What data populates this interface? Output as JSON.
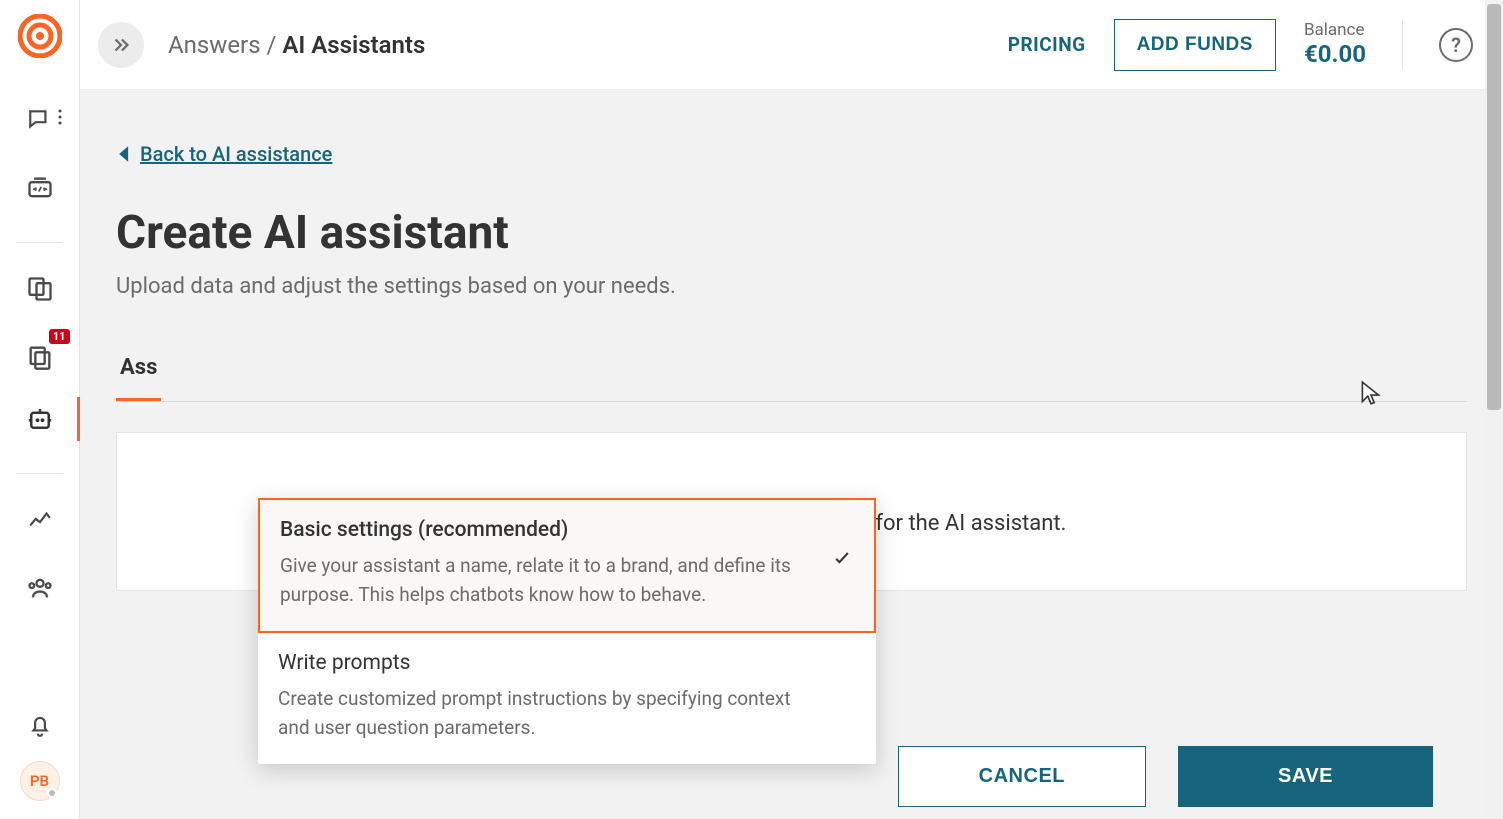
{
  "breadcrumb": {
    "parent": "Answers",
    "sep": " / ",
    "current": "AI Assistants"
  },
  "topbar": {
    "pricing": "PRICING",
    "add_funds": "ADD FUNDS",
    "balance_label": "Balance",
    "balance_value": "€0.00",
    "help": "?"
  },
  "back_link": "Back to AI assistance",
  "page_title": "Create AI assistant",
  "page_sub": "Upload data and adjust the settings based on your needs.",
  "tabs": {
    "visible_prefix": "Ass"
  },
  "panel_visible_text": "tructions for the AI assistant.",
  "dropdown": {
    "opt1": {
      "title": "Basic settings (recommended)",
      "desc": "Give your assistant a name, relate it to a brand, and define its purpose. This helps chatbots know how to behave."
    },
    "opt2": {
      "title": "Write prompts",
      "desc": "Create customized prompt instructions by specifying context and user question parameters."
    }
  },
  "footer": {
    "cancel": "CANCEL",
    "save": "SAVE"
  },
  "sidebar": {
    "badge": "11",
    "avatar": "PB"
  }
}
